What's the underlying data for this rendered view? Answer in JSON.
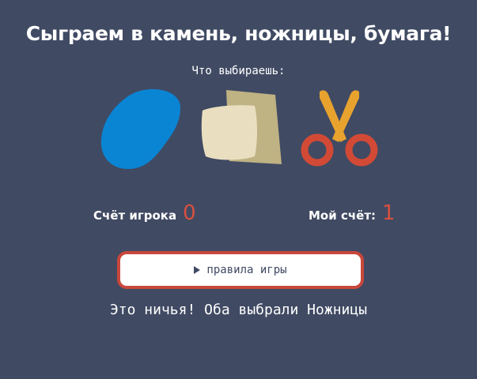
{
  "title": "Сыграем в камень, ножницы, бумага!",
  "prompt": "Что выбираешь:",
  "choices": [
    {
      "id": "rock",
      "icon": "rock-icon",
      "color": "#0a85d4"
    },
    {
      "id": "paper",
      "icon": "paper-icon",
      "colors": [
        "#bfb283",
        "#e9dfc0"
      ]
    },
    {
      "id": "scissors",
      "icon": "scissors-icon",
      "colors": [
        "#e8a22e",
        "#d24a35"
      ]
    }
  ],
  "scores": {
    "player_label": "Счёт игрока",
    "player_value": "0",
    "computer_label": "Мой счёт:",
    "computer_value": "1"
  },
  "rules_button": {
    "label": "правила игры",
    "icon": "play-icon"
  },
  "result_text": "Это ничья! Оба выбрали Ножницы",
  "colors": {
    "background": "#404a63",
    "accent": "#d9503f",
    "button_border": "#c8473b"
  }
}
